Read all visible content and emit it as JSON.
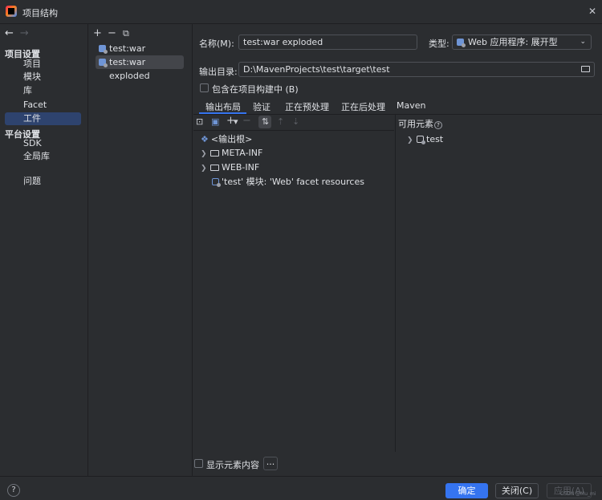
{
  "window": {
    "title": "项目结构",
    "close_glyph": "✕"
  },
  "nav": {
    "back": "←",
    "forward": "→",
    "project_settings": "项目设置",
    "items1": [
      "项目",
      "模块",
      "库",
      "Facet",
      "工件"
    ],
    "platform_settings": "平台设置",
    "items2": [
      "SDK",
      "全局库"
    ],
    "problems": "问题"
  },
  "artifacts": {
    "toolbar": {
      "add": "+",
      "remove": "−",
      "copy": "⧉"
    },
    "items": [
      "test:war",
      "test:war exploded"
    ]
  },
  "editor": {
    "name_label": "名称(M):",
    "name_value": "test:war exploded",
    "type_label": "类型:",
    "type_value": "Web 应用程序: 展开型",
    "output_label": "输出目录:",
    "output_value": "D:\\MavenProjects\\test\\target\\test",
    "include_in_build": "包含在项目构建中 (B)",
    "tabs": [
      "输出布局",
      "验证",
      "正在预处理",
      "正在后处理",
      "Maven"
    ],
    "available_elements": "可用元素",
    "tree": {
      "root": "<输出根>",
      "meta_inf": "META-INF",
      "web_inf": "WEB-INF",
      "module_resource": "'test' 模块: 'Web' facet resources"
    },
    "available_tree": {
      "test": "test"
    },
    "show_content": "显示元素内容",
    "more": "..."
  },
  "footer": {
    "help": "?",
    "ok": "确定",
    "close": "关闭(C)",
    "apply": "应用(A)",
    "watermark": "CSDN @Mu_mi"
  },
  "colors": {
    "accent": "#3574f0",
    "selection": "#2e436e",
    "background": "#2b2d30"
  }
}
